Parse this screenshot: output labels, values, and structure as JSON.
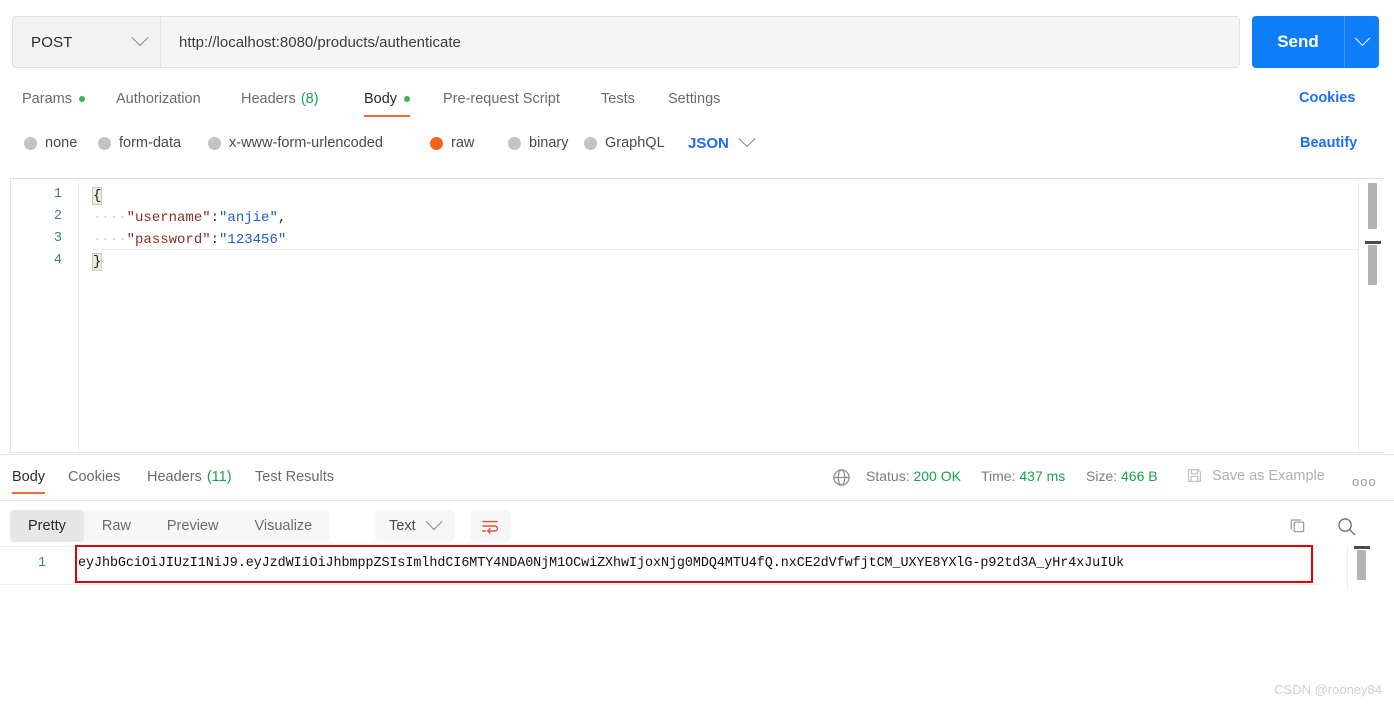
{
  "request": {
    "method": "POST",
    "url": "http://localhost:8080/products/authenticate",
    "send_label": "Send",
    "tabs": [
      {
        "label": "Params",
        "dot": true,
        "active": false
      },
      {
        "label": "Authorization",
        "dot": false,
        "active": false
      },
      {
        "label": "Headers",
        "count": "(8)",
        "dot": false,
        "active": false
      },
      {
        "label": "Body",
        "dot": true,
        "active": true
      },
      {
        "label": "Pre-request Script",
        "dot": false,
        "active": false
      },
      {
        "label": "Tests",
        "dot": false,
        "active": false
      },
      {
        "label": "Settings",
        "dot": false,
        "active": false
      }
    ],
    "cookies_link": "Cookies",
    "beautify_link": "Beautify",
    "body_types": [
      {
        "label": "none",
        "selected": false
      },
      {
        "label": "form-data",
        "selected": false
      },
      {
        "label": "x-www-form-urlencoded",
        "selected": false
      },
      {
        "label": "raw",
        "selected": true
      },
      {
        "label": "binary",
        "selected": false
      },
      {
        "label": "GraphQL",
        "selected": false
      }
    ],
    "format": "JSON",
    "editor": {
      "line_numbers": [
        "1",
        "2",
        "3",
        "4"
      ],
      "lines": [
        {
          "n": "1",
          "open_brace": "{"
        },
        {
          "n": "2",
          "indent": "····",
          "key": "\"username\"",
          "colon": ":",
          "value": "\"anjie\"",
          "tail": ","
        },
        {
          "n": "3",
          "indent": "····",
          "key": "\"password\"",
          "colon": ":",
          "value": "\"123456\"",
          "tail": ""
        },
        {
          "n": "4",
          "close_brace": "}"
        }
      ]
    }
  },
  "response": {
    "tabs": [
      {
        "label": "Body",
        "active": true
      },
      {
        "label": "Cookies",
        "active": false
      },
      {
        "label": "Headers",
        "count": "(11)",
        "active": false
      },
      {
        "label": "Test Results",
        "active": false
      }
    ],
    "status_label": "Status:",
    "status_value": "200 OK",
    "time_label": "Time:",
    "time_value": "437 ms",
    "size_label": "Size:",
    "size_value": "466 B",
    "save_as_example": "Save as Example",
    "more_dots": "ooo",
    "view_modes": [
      {
        "label": "Pretty",
        "selected": true
      },
      {
        "label": "Raw",
        "selected": false
      },
      {
        "label": "Preview",
        "selected": false
      },
      {
        "label": "Visualize",
        "selected": false
      }
    ],
    "format": "Text",
    "body_line_number": "1",
    "body_text": "eyJhbGciOiJIUzI1NiJ9.eyJzdWIiOiJhbmppZSIsImlhdCI6MTY4NDA0NjM1OCwiZXhwIjoxNjg0MDQ4MTU4fQ.nxCE2dVfwfjtCM_UXYE8YXlG-p92td3A_yHr4xJuIUk"
  },
  "watermark": "CSDN @rooney84",
  "colors": {
    "accent_orange": "#ef6c34",
    "send_blue": "#0d7ef7",
    "link_blue": "#1c6ef2",
    "status_green": "#16a34a",
    "highlight_red": "#e00000",
    "raw_radio": "#f26322"
  }
}
